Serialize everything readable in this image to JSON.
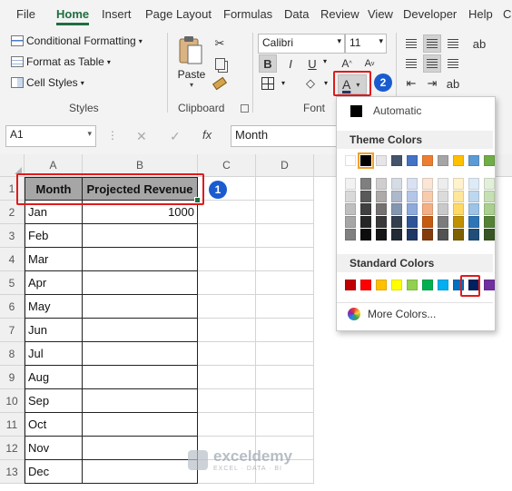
{
  "ribbon_tabs": [
    "File",
    "Home",
    "Insert",
    "Page Layout",
    "Formulas",
    "Data",
    "Review",
    "View",
    "Developer",
    "Help",
    "C"
  ],
  "styles_group": {
    "conditional_formatting": "Conditional Formatting",
    "format_as_table": "Format as Table",
    "cell_styles": "Cell Styles",
    "label": "Styles"
  },
  "clipboard_group": {
    "paste": "Paste",
    "label": "Clipboard"
  },
  "font_group": {
    "font_name": "Calibri",
    "font_size": "11",
    "bold": "B",
    "italic": "I",
    "underline": "U",
    "font_color_letter": "A",
    "label": "Font"
  },
  "formula_bar": {
    "name_box": "A1",
    "fx": "fx",
    "formula": "Month"
  },
  "columns": [
    "A",
    "B",
    "C",
    "D"
  ],
  "rows": [
    "1",
    "2",
    "3",
    "4",
    "5",
    "6",
    "7",
    "8",
    "9",
    "10",
    "11",
    "12",
    "13"
  ],
  "table": {
    "headers": [
      "Month",
      "Projected Revenue"
    ],
    "months": [
      "Jan",
      "Feb",
      "Mar",
      "Apr",
      "May",
      "Jun",
      "Jul",
      "Aug",
      "Sep",
      "Oct",
      "Nov",
      "Dec"
    ],
    "revenue": [
      "1000",
      "",
      "",
      "",
      "",
      "",
      "",
      "",
      "",
      "",
      "",
      ""
    ]
  },
  "dropdown": {
    "automatic": "Automatic",
    "theme_colors": "Theme Colors",
    "standard_colors": "Standard Colors",
    "more_colors": "More Colors...",
    "theme_top": [
      "#ffffff",
      "#000000",
      "#e7e6e6",
      "#44546a",
      "#4472c4",
      "#ed7d31",
      "#a5a5a5",
      "#ffc000",
      "#5b9bd5",
      "#70ad47"
    ],
    "theme_shades": [
      [
        "#f2f2f2",
        "#d9d9d9",
        "#bfbfbf",
        "#a6a6a6",
        "#808080"
      ],
      [
        "#7f7f7f",
        "#595959",
        "#404040",
        "#262626",
        "#0d0d0d"
      ],
      [
        "#d0cece",
        "#aeaaaa",
        "#757171",
        "#3a3838",
        "#171616"
      ],
      [
        "#d6dce4",
        "#adb9ca",
        "#8497b0",
        "#333f4f",
        "#222a35"
      ],
      [
        "#d9e1f2",
        "#b4c6e7",
        "#8ea9db",
        "#2f5597",
        "#203864"
      ],
      [
        "#fbe5d6",
        "#f8cbad",
        "#f4b084",
        "#c55a11",
        "#843c0c"
      ],
      [
        "#ededed",
        "#dbdbdb",
        "#c9c9c9",
        "#7b7b7b",
        "#525252"
      ],
      [
        "#fff2cc",
        "#ffe699",
        "#ffd966",
        "#bf9000",
        "#7f6000"
      ],
      [
        "#deebf7",
        "#bdd7ee",
        "#9dc3e6",
        "#2e75b6",
        "#1f4e79"
      ],
      [
        "#e2efda",
        "#c6e0b4",
        "#a9d08e",
        "#548235",
        "#375623"
      ]
    ],
    "standard": [
      "#c00000",
      "#ff0000",
      "#ffc000",
      "#ffff00",
      "#92d050",
      "#00b050",
      "#00b0f0",
      "#0070c0",
      "#002060",
      "#7030a0"
    ]
  },
  "badges": [
    "1",
    "2"
  ],
  "watermark": {
    "name": "exceldemy",
    "tagline": "EXCEL · DATA · BI"
  }
}
